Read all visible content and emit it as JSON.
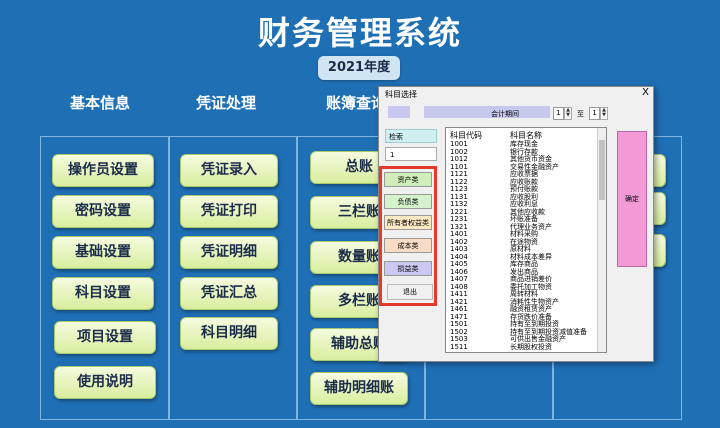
{
  "app": {
    "title": "财务管理系统",
    "year": "2021年度"
  },
  "sections": {
    "basic": "基本信息",
    "voucher": "凭证处理",
    "ledger": "账簿查询"
  },
  "buttons": {
    "basic": [
      "操作员设置",
      "密码设置",
      "基础设置",
      "科目设置",
      "项目设置",
      "使用说明"
    ],
    "voucher": [
      "凭证录入",
      "凭证打印",
      "凭证明细",
      "凭证汇总",
      "科目明细"
    ],
    "ledger": [
      "总账",
      "三栏账",
      "数量账",
      "多栏账",
      "辅助总账",
      "辅助明细账"
    ]
  },
  "dialog": {
    "title": "科目选择",
    "close": "X",
    "period_label": "会计期间",
    "period_from": "1",
    "to_label": "至",
    "period_to": "1",
    "search_label": "检索",
    "search_value": "1",
    "categories": [
      "资产类",
      "负债类",
      "所有者权益类",
      "成本类",
      "损益类"
    ],
    "exit_label": "退出",
    "confirm_label": "确定",
    "list_headers": [
      "科目代码",
      "科目名称"
    ],
    "accounts": [
      [
        "1001",
        "库存现金"
      ],
      [
        "1002",
        "银行存款"
      ],
      [
        "1012",
        "其他货币资金"
      ],
      [
        "1101",
        "交易性金融资产"
      ],
      [
        "1121",
        "应收票据"
      ],
      [
        "1122",
        "应收账款"
      ],
      [
        "1123",
        "预付账款"
      ],
      [
        "1131",
        "应收股利"
      ],
      [
        "1132",
        "应收利息"
      ],
      [
        "1221",
        "其他应收款"
      ],
      [
        "1231",
        "坏账准备"
      ],
      [
        "1321",
        "代理业务资产"
      ],
      [
        "1401",
        "材料采购"
      ],
      [
        "1402",
        "在途物资"
      ],
      [
        "1403",
        "原材料"
      ],
      [
        "1404",
        "材料成本差异"
      ],
      [
        "1405",
        "库存商品"
      ],
      [
        "1406",
        "发出商品"
      ],
      [
        "1407",
        "商品进销差价"
      ],
      [
        "1408",
        "委托加工物资"
      ],
      [
        "1411",
        "周转材料"
      ],
      [
        "1421",
        "消耗性生物资产"
      ],
      [
        "1461",
        "融资租赁资产"
      ],
      [
        "1471",
        "存货跌价准备"
      ],
      [
        "1501",
        "持有至到期投资"
      ],
      [
        "1502",
        "持有至到期投资减值准备"
      ],
      [
        "1503",
        "可供出售金融资产"
      ],
      [
        "1511",
        "长期股权投资"
      ]
    ]
  }
}
